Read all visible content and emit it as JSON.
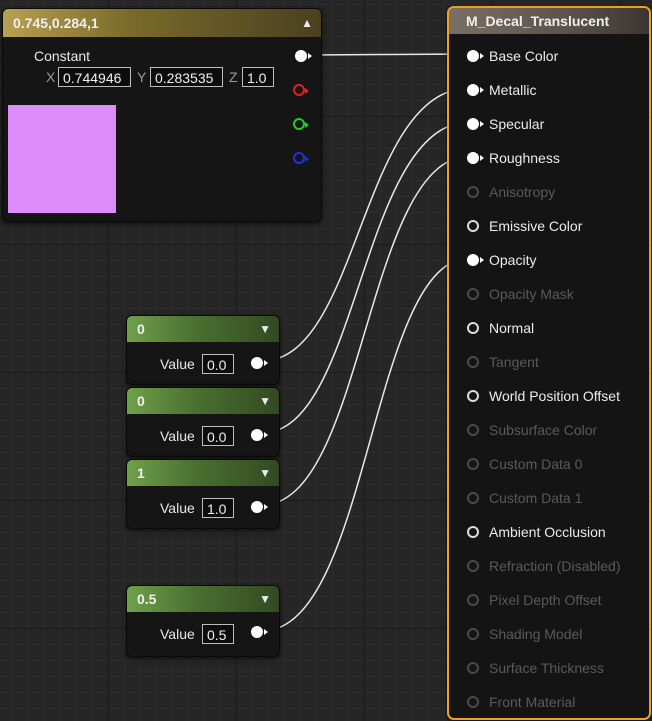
{
  "constant3_node": {
    "title": "0.745,0.284,1",
    "output_label": "Constant",
    "x_label": "X",
    "x_value": "0.744946",
    "y_label": "Y",
    "y_value": "0.283535",
    "z_label": "Z",
    "z_value": "1.0",
    "swatch_color": "#dc8dfb",
    "channel_colors": [
      "#e02020",
      "#20d020",
      "#2030e0"
    ]
  },
  "scalar_nodes": [
    {
      "title": "0",
      "value_label": "Value",
      "value": "0.0"
    },
    {
      "title": "0",
      "value_label": "Value",
      "value": "0.0"
    },
    {
      "title": "1",
      "value_label": "Value",
      "value": "1.0"
    },
    {
      "title": "0.5",
      "value_label": "Value",
      "value": "0.5"
    }
  ],
  "material_node": {
    "title": "M_Decal_Translucent",
    "accent": "#f0a020",
    "pins": [
      {
        "label": "Base Color",
        "state": "connected"
      },
      {
        "label": "Metallic",
        "state": "connected"
      },
      {
        "label": "Specular",
        "state": "connected"
      },
      {
        "label": "Roughness",
        "state": "connected"
      },
      {
        "label": "Anisotropy",
        "state": "disabled"
      },
      {
        "label": "Emissive Color",
        "state": "available"
      },
      {
        "label": "Opacity",
        "state": "connected"
      },
      {
        "label": "Opacity Mask",
        "state": "disabled"
      },
      {
        "label": "Normal",
        "state": "available"
      },
      {
        "label": "Tangent",
        "state": "disabled"
      },
      {
        "label": "World Position Offset",
        "state": "available"
      },
      {
        "label": "Subsurface Color",
        "state": "disabled"
      },
      {
        "label": "Custom Data 0",
        "state": "disabled"
      },
      {
        "label": "Custom Data 1",
        "state": "disabled"
      },
      {
        "label": "Ambient Occlusion",
        "state": "available"
      },
      {
        "label": "Refraction (Disabled)",
        "state": "disabled"
      },
      {
        "label": "Pixel Depth Offset",
        "state": "disabled"
      },
      {
        "label": "Shading Model",
        "state": "disabled"
      },
      {
        "label": "Surface Thickness",
        "state": "disabled"
      },
      {
        "label": "Front Material",
        "state": "disabled"
      }
    ]
  }
}
